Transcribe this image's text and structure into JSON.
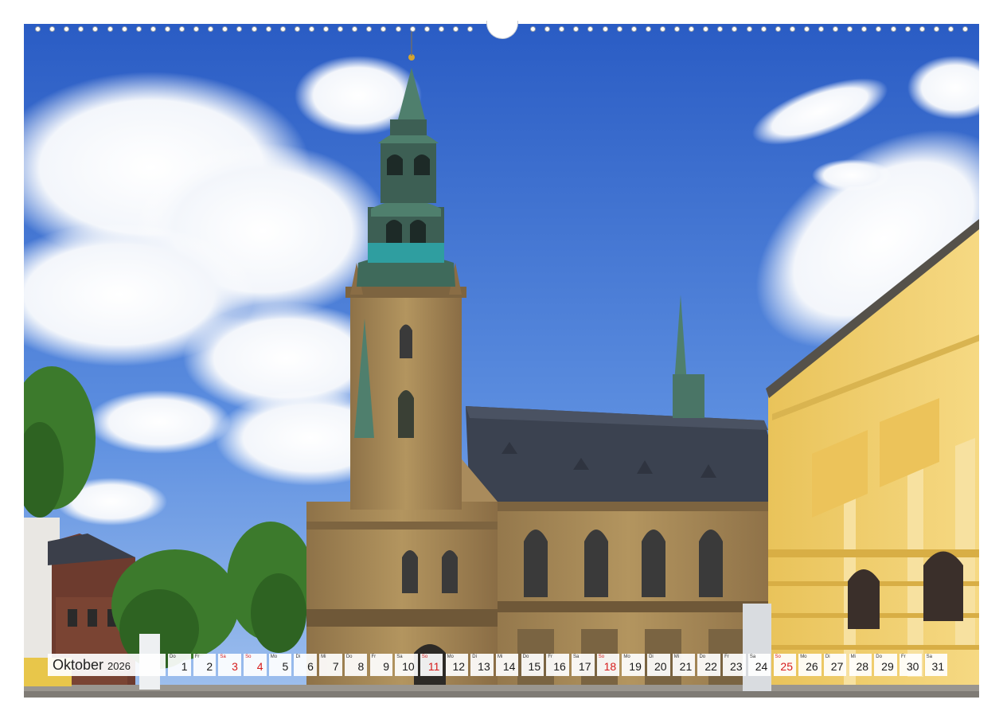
{
  "calendar": {
    "month": "Oktober",
    "year": "2026",
    "days": [
      {
        "wd": "Do",
        "n": "1",
        "kind": "normal"
      },
      {
        "wd": "Fr",
        "n": "2",
        "kind": "normal"
      },
      {
        "wd": "Sa",
        "n": "3",
        "kind": "hol"
      },
      {
        "wd": "So",
        "n": "4",
        "kind": "sun"
      },
      {
        "wd": "Mo",
        "n": "5",
        "kind": "normal"
      },
      {
        "wd": "Di",
        "n": "6",
        "kind": "normal"
      },
      {
        "wd": "Mi",
        "n": "7",
        "kind": "normal"
      },
      {
        "wd": "Do",
        "n": "8",
        "kind": "normal"
      },
      {
        "wd": "Fr",
        "n": "9",
        "kind": "normal"
      },
      {
        "wd": "Sa",
        "n": "10",
        "kind": "normal"
      },
      {
        "wd": "So",
        "n": "11",
        "kind": "sun"
      },
      {
        "wd": "Mo",
        "n": "12",
        "kind": "normal"
      },
      {
        "wd": "Di",
        "n": "13",
        "kind": "normal"
      },
      {
        "wd": "Mi",
        "n": "14",
        "kind": "normal"
      },
      {
        "wd": "Do",
        "n": "15",
        "kind": "normal"
      },
      {
        "wd": "Fr",
        "n": "16",
        "kind": "normal"
      },
      {
        "wd": "Sa",
        "n": "17",
        "kind": "normal"
      },
      {
        "wd": "So",
        "n": "18",
        "kind": "sun"
      },
      {
        "wd": "Mo",
        "n": "19",
        "kind": "normal"
      },
      {
        "wd": "Di",
        "n": "20",
        "kind": "normal"
      },
      {
        "wd": "Mi",
        "n": "21",
        "kind": "normal"
      },
      {
        "wd": "Do",
        "n": "22",
        "kind": "normal"
      },
      {
        "wd": "Fr",
        "n": "23",
        "kind": "normal"
      },
      {
        "wd": "Sa",
        "n": "24",
        "kind": "normal"
      },
      {
        "wd": "So",
        "n": "25",
        "kind": "sun"
      },
      {
        "wd": "Mo",
        "n": "26",
        "kind": "normal"
      },
      {
        "wd": "Di",
        "n": "27",
        "kind": "normal"
      },
      {
        "wd": "Mi",
        "n": "28",
        "kind": "normal"
      },
      {
        "wd": "Do",
        "n": "29",
        "kind": "normal"
      },
      {
        "wd": "Fr",
        "n": "30",
        "kind": "normal"
      },
      {
        "wd": "Sa",
        "n": "31",
        "kind": "normal"
      }
    ]
  },
  "colors": {
    "sky_top": "#2f63c9",
    "sky_bottom": "#8fb6ea",
    "stone": "#a98b5c",
    "roof": "#3b4250",
    "patina": "#4f7f6d",
    "building_yellow": "#f0cf6e",
    "holiday_red": "#d61b1b"
  }
}
